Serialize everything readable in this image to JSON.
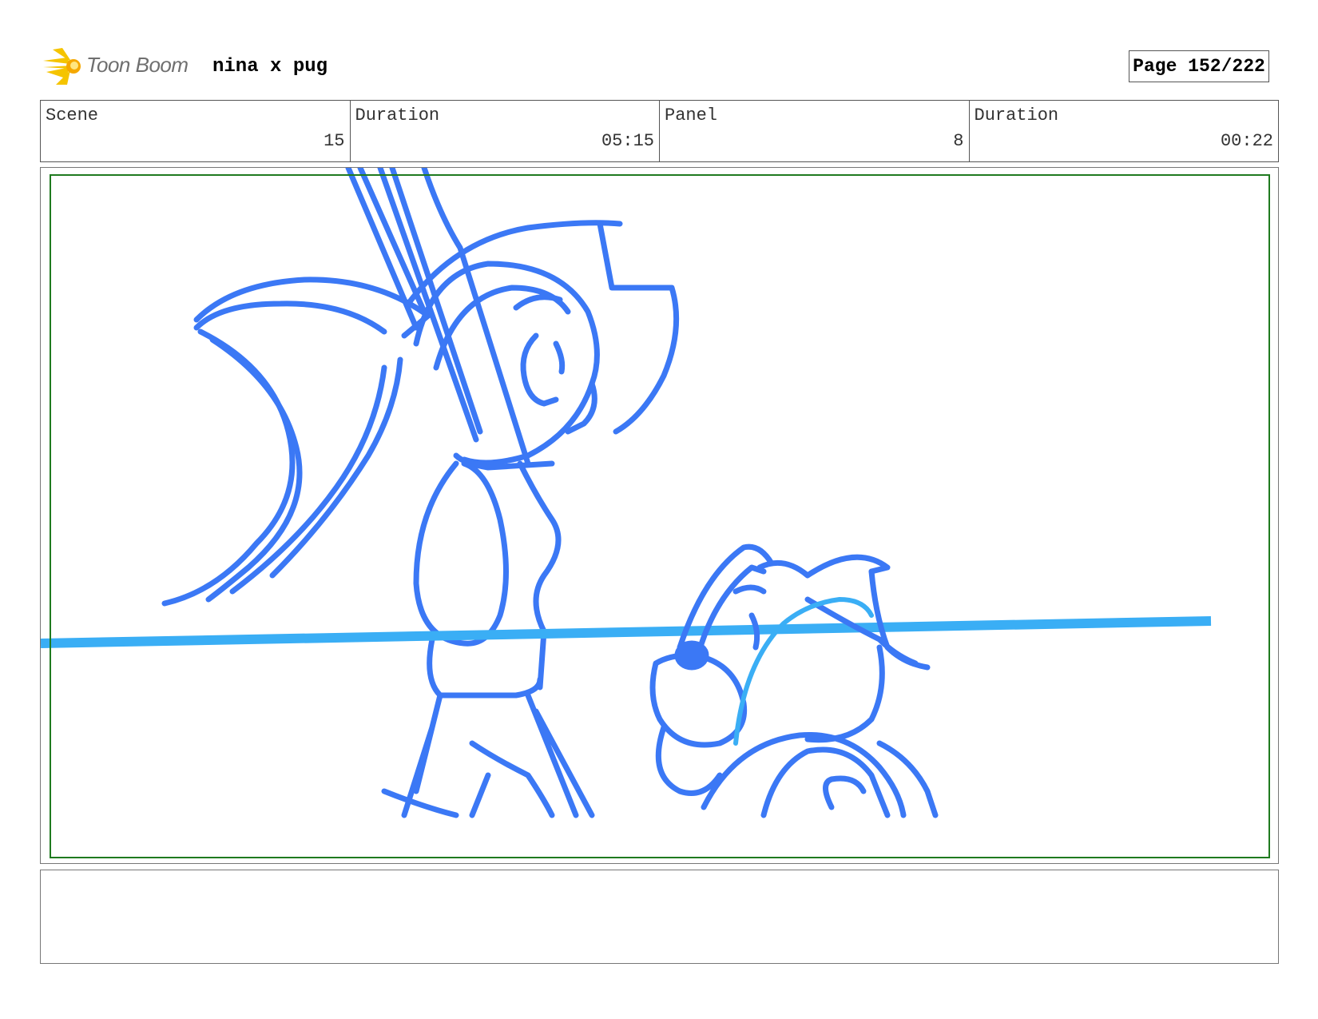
{
  "header": {
    "brand_name": "Toon Boom",
    "project_title": "nina x pug",
    "page_label": "Page 152/222"
  },
  "info": {
    "scene_label": "Scene",
    "scene_value": "15",
    "scene_duration_label": "Duration",
    "scene_duration_value": "05:15",
    "panel_label": "Panel",
    "panel_value": "8",
    "panel_duration_label": "Duration",
    "panel_duration_value": "00:22"
  },
  "colors": {
    "sketch_stroke": "#3b78f5",
    "horizon_line": "#3aaef5",
    "safe_area_border": "#1f7a1f",
    "logo_flame": "#f5c400"
  },
  "notes": {
    "text": ""
  }
}
